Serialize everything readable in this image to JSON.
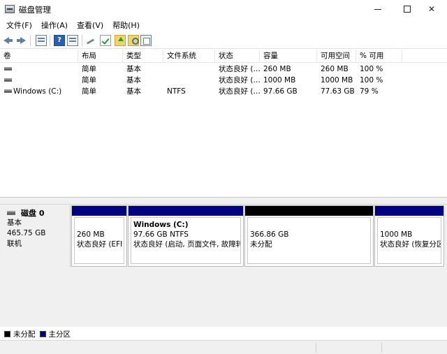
{
  "window": {
    "title": "磁盘管理",
    "icon": "disk-management-icon"
  },
  "menu": [
    "文件(F)",
    "操作(A)",
    "查看(V)",
    "帮助(H)"
  ],
  "toolbar": {
    "icons": [
      "back-arrow-icon",
      "forward-arrow-icon",
      "console-tree-icon",
      "help-icon",
      "view-icon",
      "connect-key-icon",
      "check-disk-icon",
      "folder-up-icon",
      "folder-search-icon",
      "properties-icon"
    ],
    "help_glyph": "?"
  },
  "volume_list": {
    "columns": [
      "卷",
      "布局",
      "类型",
      "文件系统",
      "状态",
      "容量",
      "可用空间",
      "% 可用"
    ],
    "rows": [
      {
        "volume": "",
        "layout": "简单",
        "type": "基本",
        "fs": "",
        "status": "状态良好 (…",
        "capacity": "260 MB",
        "free": "260 MB",
        "pct": "100 %"
      },
      {
        "volume": "",
        "layout": "简单",
        "type": "基本",
        "fs": "",
        "status": "状态良好 (…",
        "capacity": "1000 MB",
        "free": "1000 MB",
        "pct": "100 %"
      },
      {
        "volume": "Windows (C:)",
        "layout": "简单",
        "type": "基本",
        "fs": "NTFS",
        "status": "状态良好 (…",
        "capacity": "97.66 GB",
        "free": "77.63 GB",
        "pct": "79 %"
      }
    ]
  },
  "disk": {
    "name": "磁盘 0",
    "type": "基本",
    "size": "465.75 GB",
    "status": "联机"
  },
  "partitions": [
    {
      "title": "",
      "size": "260 MB",
      "status": "状态良好 (EFI 系",
      "bar_color": "#000080"
    },
    {
      "title": "Windows  (C:)",
      "size": "97.66 GB NTFS",
      "status": "状态良好 (启动, 页面文件, 故障转",
      "bar_color": "#000080"
    },
    {
      "title": "",
      "size": "366.86 GB",
      "status": "未分配",
      "bar_color": "#000000"
    },
    {
      "title": "",
      "size": "1000 MB",
      "status": "状态良好 (恢复分区",
      "bar_color": "#000080"
    }
  ],
  "legend": [
    {
      "label": "未分配",
      "color": "#000000"
    },
    {
      "label": "主分区",
      "color": "#000080"
    }
  ]
}
